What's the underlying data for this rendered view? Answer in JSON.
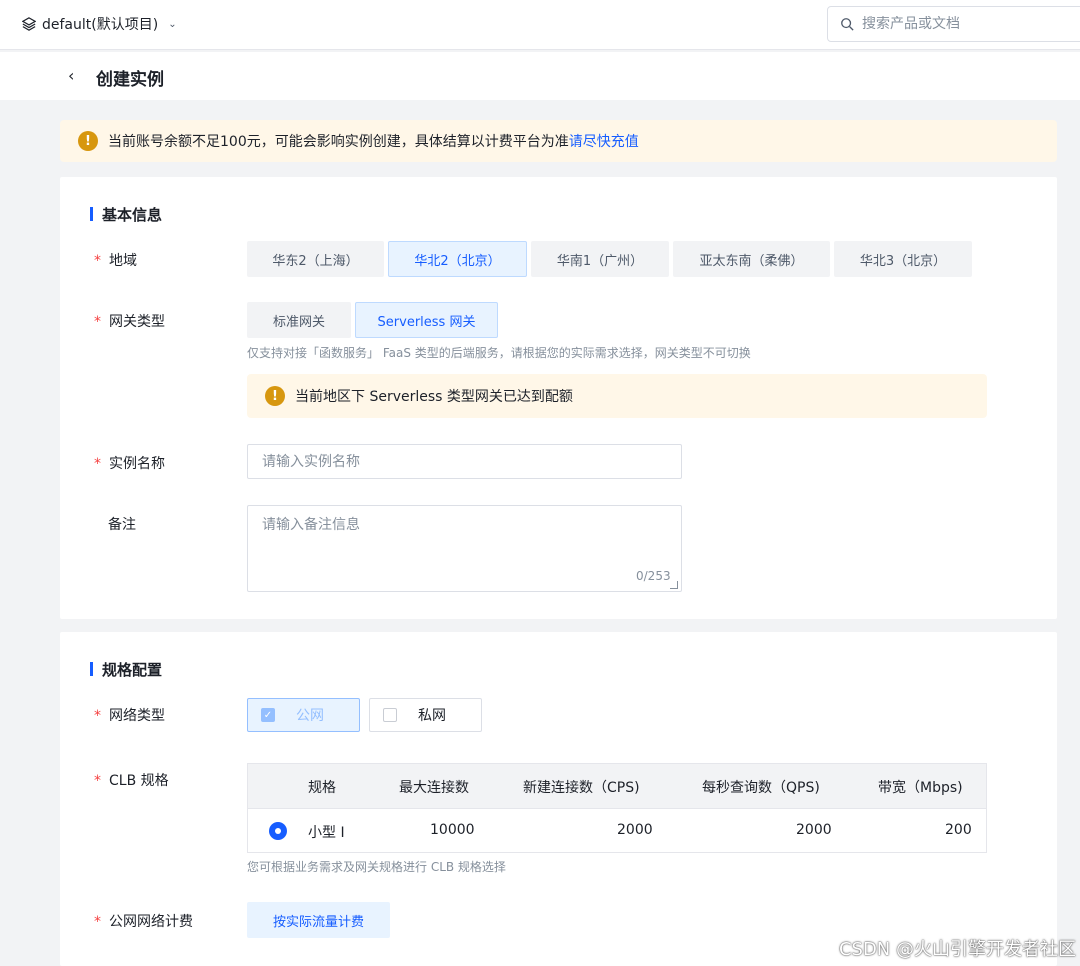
{
  "header": {
    "project": "default(默认项目)",
    "search_placeholder": "搜索产品或文档"
  },
  "page": {
    "title": "创建实例"
  },
  "balance_alert": {
    "text": "当前账号余额不足100元，可能会影响实例创建，具体结算以计费平台为准",
    "link": "请尽快充值"
  },
  "basic": {
    "section_title": "基本信息",
    "region_label": "地域",
    "regions": [
      "华东2（上海）",
      "华北2（北京）",
      "华南1（广州）",
      "亚太东南（柔佛）",
      "华北3（北京）"
    ],
    "selected_region": "华北2（北京）",
    "gateway_label": "网关类型",
    "gateway_types": [
      "标准网关",
      "Serverless 网关"
    ],
    "selected_gateway": "Serverless 网关",
    "gateway_hint": "仅支持对接「函数服务」 FaaS 类型的后端服务，请根据您的实际需求选择，网关类型不可切换",
    "quota_alert": "当前地区下 Serverless 类型网关已达到配额",
    "name_label": "实例名称",
    "name_placeholder": "请输入实例名称",
    "note_label": "备注",
    "note_placeholder": "请输入备注信息",
    "note_counter": "0/253"
  },
  "spec": {
    "section_title": "规格配置",
    "network_label": "网络类型",
    "network_options": [
      "公网",
      "私网"
    ],
    "network_selected": "公网",
    "clb_label": "CLB 规格",
    "clb_columns": [
      "规格",
      "最大连接数",
      "新建连接数（CPS)",
      "每秒查询数（QPS)",
      "带宽（Mbps)"
    ],
    "clb_rows": [
      [
        "小型 I",
        "10000",
        "2000",
        "2000",
        "200"
      ]
    ],
    "clb_hint": "您可根据业务需求及网关规格进行 CLB 规格选择",
    "billing_label": "公网网络计费",
    "billing_option": "按实际流量计费"
  },
  "watermark": "CSDN @火山引擎开发者社区",
  "icons": {
    "warning": "!",
    "back": "‹",
    "search": "search-icon",
    "layers": "layers-icon",
    "chevron": "⌄"
  }
}
